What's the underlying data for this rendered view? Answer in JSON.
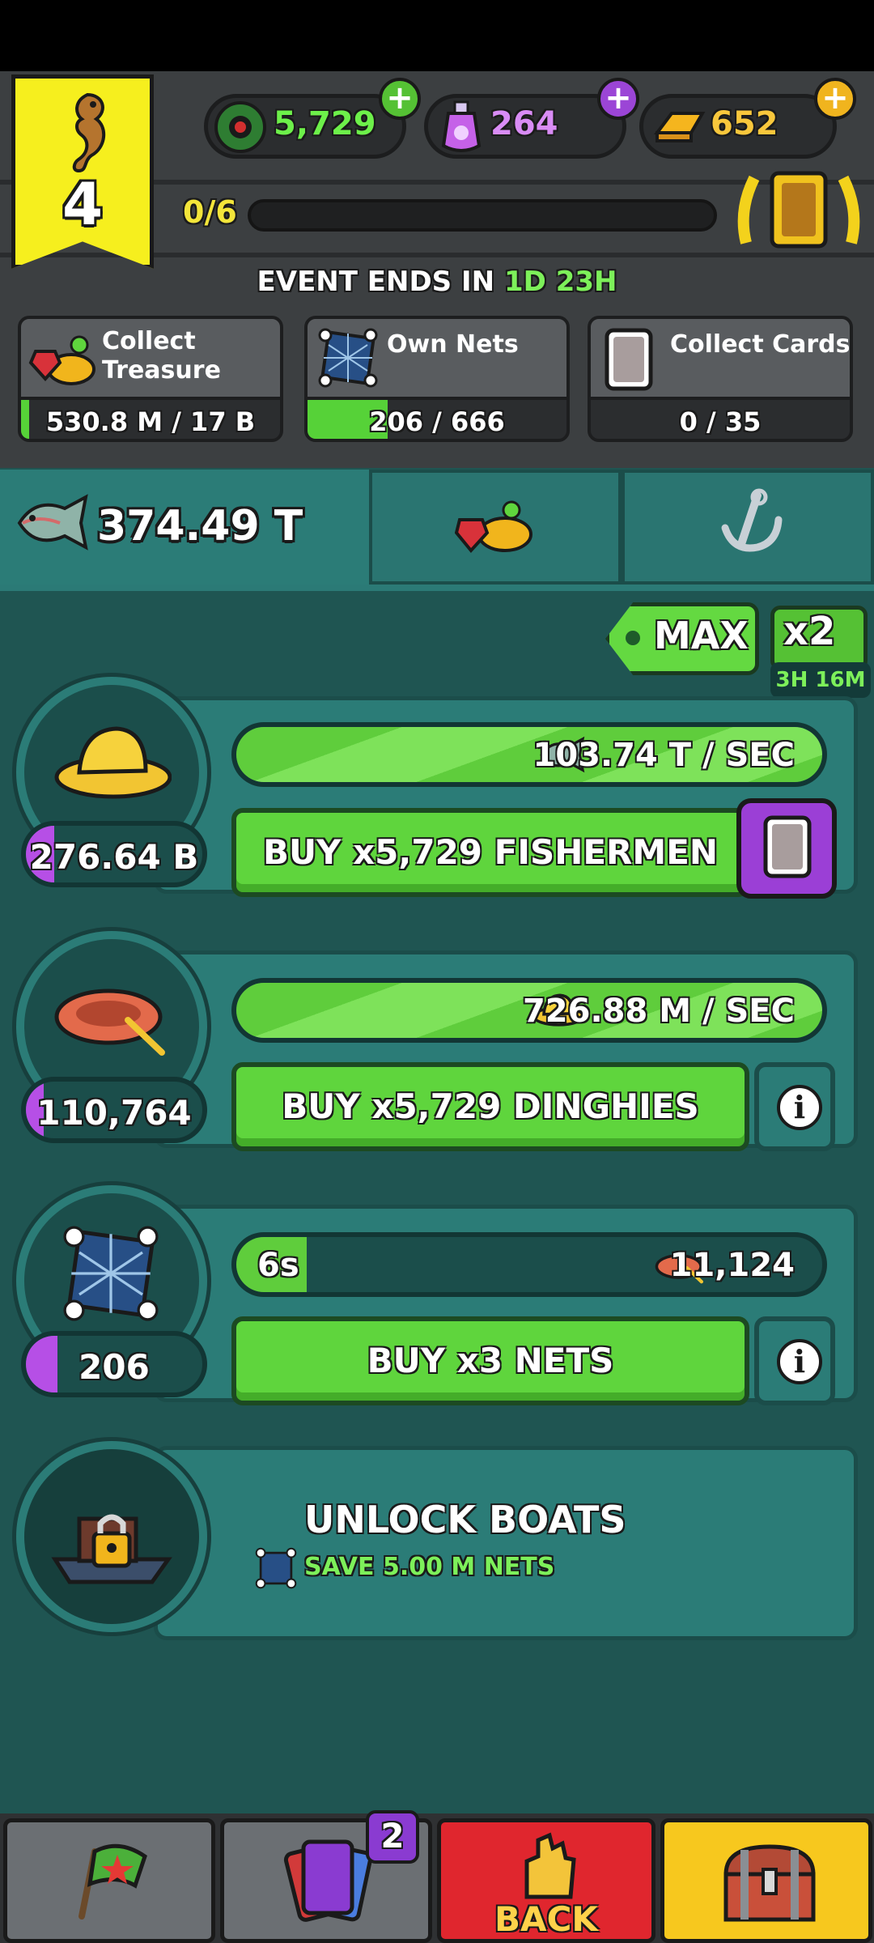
{
  "currency": {
    "cash": "5,729",
    "potions": "264",
    "gold": "652"
  },
  "event": {
    "level": "4",
    "progress_label": "0/6",
    "progress_fraction": 0.0,
    "ends_prefix": "EVENT ENDS IN ",
    "ends_days": "1D",
    "ends_hours": "23H"
  },
  "quests": [
    {
      "title_line1": "Collect",
      "title_line2": "Treasure",
      "progress": "530.8 M / 17 B",
      "fraction": 0.03
    },
    {
      "title_line1": "Own Nets",
      "title_line2": "",
      "progress": "206 / 666",
      "fraction": 0.31
    },
    {
      "title_line1": "Collect Cards",
      "title_line2": "",
      "progress": "0 / 35",
      "fraction": 0.0
    }
  ],
  "fish_total": "374.49 T",
  "multiplier": {
    "max_label": "MAX",
    "x2_label": "x2",
    "x2_timer": "3H 16M"
  },
  "rows": [
    {
      "count": "276.64 B",
      "count_fraction": 0.16,
      "rate": "103.74 T / SEC",
      "rate_fraction": 1.0,
      "buy": "BUY x5,729 FISHERMEN"
    },
    {
      "count": "110,764",
      "count_fraction": 0.1,
      "rate": "726.88 M / SEC",
      "rate_fraction": 1.0,
      "buy": "BUY x5,729 DINGHIES"
    },
    {
      "count": "206",
      "count_fraction": 0.18,
      "timer": "6s",
      "rate": "11,124",
      "rate_fraction": 0.12,
      "buy": "BUY x3 NETS"
    }
  ],
  "unlock": {
    "title": "UNLOCK BOATS",
    "subtitle": "SAVE 5.00 M NETS"
  },
  "nav": {
    "cards_badge": "2",
    "back_label": "BACK"
  },
  "colors": {
    "green": "#5fd53d",
    "teal": "#2b7c77",
    "purple": "#b64fe6",
    "yellow": "#f6ef1e"
  }
}
